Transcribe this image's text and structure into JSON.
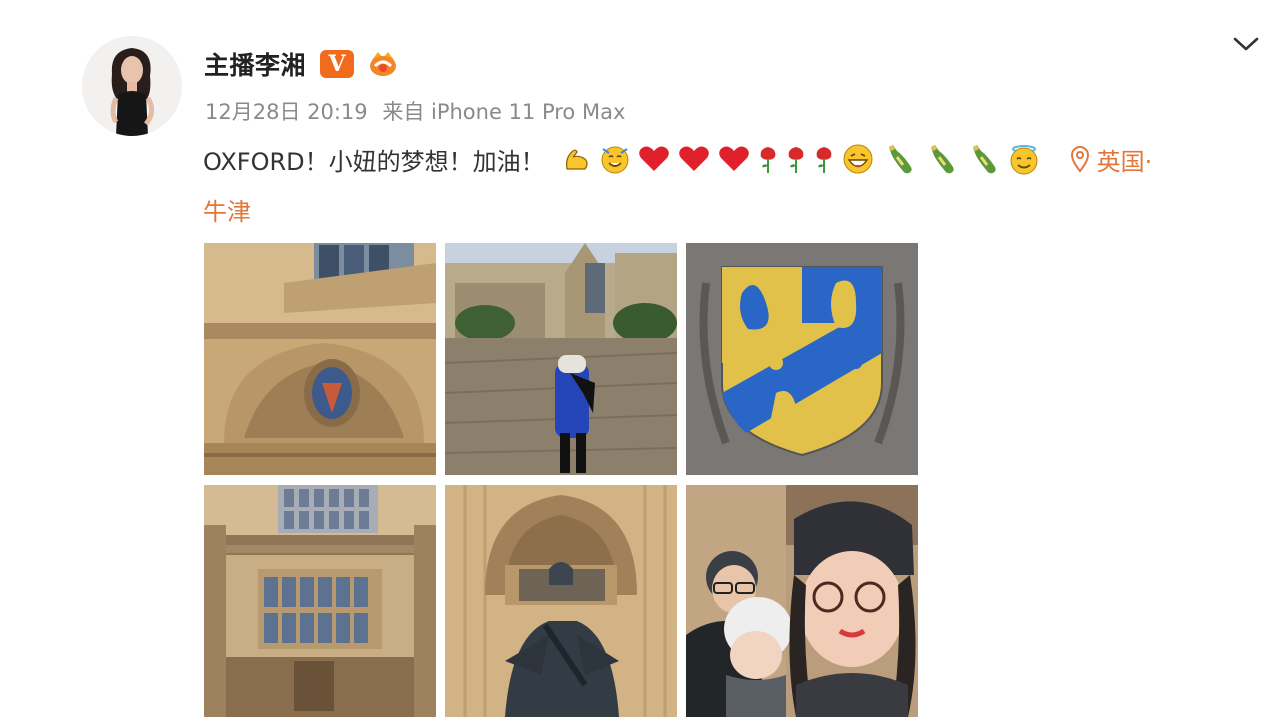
{
  "post": {
    "author_name": "主播李湘",
    "verified_label": "V",
    "timestamp": "12月28日 20:19",
    "source": "来自 iPhone 11 Pro Max",
    "text": "OXFORD！小妞的梦想！加油！",
    "emojis": [
      "strong-arm",
      "cheer-face",
      "heart",
      "heart",
      "heart",
      "rose",
      "rose",
      "rose",
      "grin-face",
      "champagne",
      "champagne",
      "champagne",
      "halo-face"
    ],
    "location_part1": "英国·",
    "location_part2": "牛津",
    "photos": [
      {
        "name": "photo-building-facade"
      },
      {
        "name": "photo-girl-in-courtyard"
      },
      {
        "name": "photo-coat-of-arms"
      },
      {
        "name": "photo-gothic-windows"
      },
      {
        "name": "photo-statue"
      },
      {
        "name": "photo-family-selfie"
      }
    ]
  },
  "colors": {
    "accent_orange": "#e3773a",
    "verified_orange": "#f26a1c",
    "meta_grey": "#8a8a8a"
  }
}
